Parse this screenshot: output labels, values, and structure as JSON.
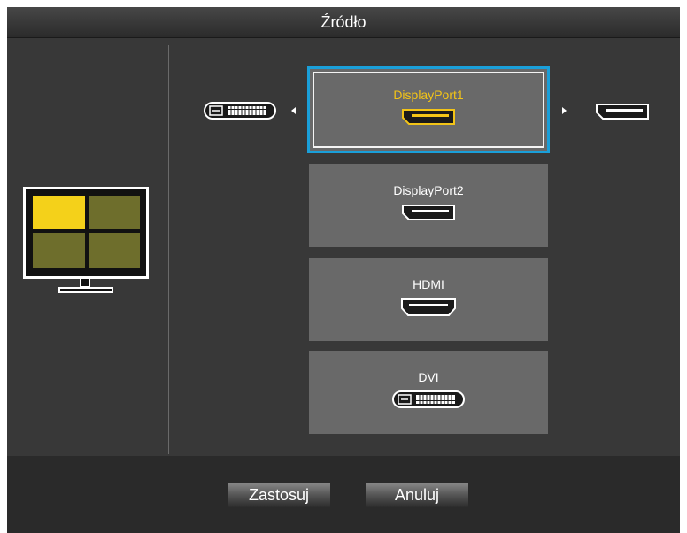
{
  "title": "Źródło",
  "sources": [
    {
      "label": "DisplayPort1",
      "connector": "displayport-icon",
      "selected": true
    },
    {
      "label": "DisplayPort2",
      "connector": "displayport-icon",
      "selected": false
    },
    {
      "label": "HDMI",
      "connector": "hdmi-icon",
      "selected": false
    },
    {
      "label": "DVI",
      "connector": "dvi-icon",
      "selected": false
    }
  ],
  "carousel": {
    "prev_icon": "dvi-icon",
    "next_icon": "displayport-icon"
  },
  "buttons": {
    "apply": "Zastosuj",
    "cancel": "Anuluj"
  },
  "colors": {
    "selected_label": "#f3c417",
    "selection_border": "#1a9fd9",
    "active_pane": "#f4d11a",
    "inactive_pane": "#6e6e2c"
  }
}
